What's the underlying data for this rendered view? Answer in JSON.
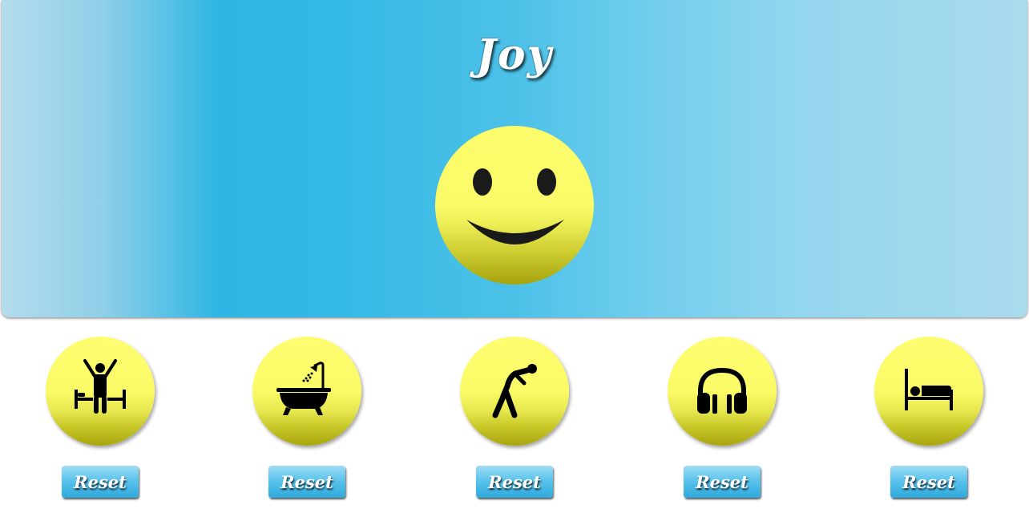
{
  "mood": {
    "title": "Joy",
    "face": "smiley-face-icon"
  },
  "activities": [
    {
      "icon": "wake-up-icon",
      "reset_label": "Reset"
    },
    {
      "icon": "bath-shower-icon",
      "reset_label": "Reset"
    },
    {
      "icon": "stretching-exercise-icon",
      "reset_label": "Reset"
    },
    {
      "icon": "headphones-icon",
      "reset_label": "Reset"
    },
    {
      "icon": "bed-sleep-icon",
      "reset_label": "Reset"
    }
  ],
  "colors": {
    "banner_blue": "#2fb6e4",
    "smiley_yellow": "#fbfb68",
    "button_blue": "#5cc4ec"
  }
}
